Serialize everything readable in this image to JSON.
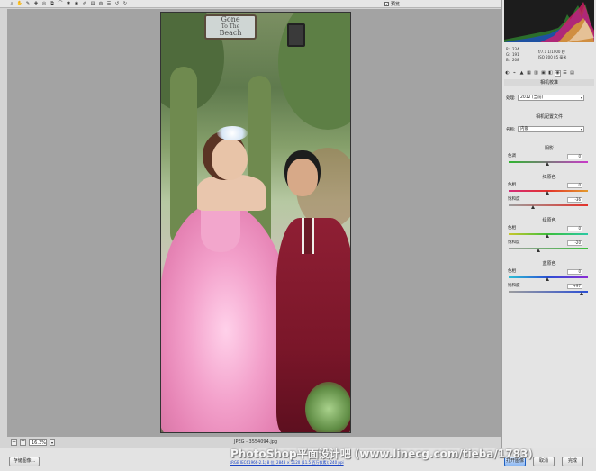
{
  "toolbar": {
    "tool_icons": [
      "zoom-icon",
      "hand-icon",
      "white-balance-icon",
      "color-sampler-icon",
      "target-adjust-icon",
      "crop-icon",
      "straighten-icon",
      "spot-removal-icon",
      "red-eye-icon",
      "adjustment-brush-icon",
      "graduated-filter-icon",
      "radial-filter-icon",
      "preferences-icon",
      "rotate-left-icon",
      "rotate-right-icon"
    ],
    "tool_glyphs": [
      "⌕",
      "✋",
      "✎",
      "✚",
      "◎",
      "⧉",
      "⌒",
      "✱",
      "◉",
      "✐",
      "▤",
      "◍",
      "☰",
      "↺",
      "↻"
    ],
    "preview_checked": true,
    "preview_check_glyph": "✓",
    "preview_label": "预览"
  },
  "photo": {
    "sign_line1": "Gone",
    "sign_line2": "To The",
    "sign_line3": "Beach"
  },
  "zoom": {
    "minus": "−",
    "plus": "+",
    "value": "16.3%",
    "arrow": "▾"
  },
  "filename": "JPEG - 3554094.jpg",
  "bottom": {
    "save_label": "存储图像...",
    "workflow_link": "sRGB IEC61966-2.1; 8 位; 2848 × 5120 (11.5 百万像素); 240 ppi",
    "open_label": "打开图像",
    "cancel_label": "取消",
    "done_label": "完成",
    "watermark": "PhotoShop平面设计吧 (www.linecg.com/tieba/1783)"
  },
  "readout": {
    "r_key": "R:",
    "r_value": "234",
    "g_key": "G:",
    "g_value": "191",
    "b_key": "B:",
    "b_value": "208",
    "exposure_line1": "f/7.1  1/1000 秒",
    "exposure_line2": "ISO 200  85 毫米"
  },
  "panel": {
    "tab_icons": [
      "basic-tab-icon",
      "tone-curve-tab-icon",
      "detail-tab-icon",
      "hsl-tab-icon",
      "split-toning-tab-icon",
      "lens-tab-icon",
      "effects-tab-icon",
      "camera-calibration-tab-icon",
      "presets-tab-icon",
      "snapshots-tab-icon"
    ],
    "tab_glyphs": [
      "◐",
      "⌁",
      "▲",
      "▦",
      "▥",
      "▣",
      "◧",
      "◉",
      "☰",
      "▤"
    ],
    "active_tab_index": 7,
    "section_title": "相机校准",
    "process_label": "处理:",
    "process_value": "2012 (当前)",
    "profile_heading": "相机配置文件",
    "name_label": "名称:",
    "name_value": "内嵌",
    "select_arrow": "▾"
  },
  "calibration": {
    "shadows": {
      "title": "阴影",
      "tint_label": "色调",
      "tint_value": "0"
    },
    "red": {
      "title": "红原色",
      "hue_label": "色相",
      "hue_value": "0",
      "sat_label": "饱和度",
      "sat_value": "-36"
    },
    "green": {
      "title": "绿原色",
      "hue_label": "色相",
      "hue_value": "0",
      "sat_label": "饱和度",
      "sat_value": "-20"
    },
    "blue": {
      "title": "蓝原色",
      "hue_label": "色相",
      "hue_value": "0",
      "sat_label": "饱和度",
      "sat_value": "+97"
    }
  },
  "colors": {
    "accent_button": "#8bb7f2",
    "link": "#1a44c4",
    "canvas": "#a3a3a3"
  }
}
